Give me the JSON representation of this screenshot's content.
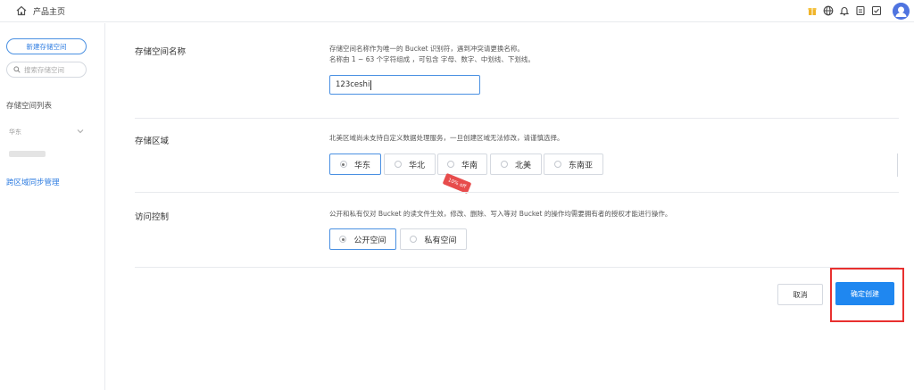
{
  "topbar": {
    "title": "产品主页",
    "icons": [
      "home-icon",
      "gift-icon",
      "globe-icon",
      "bell-icon",
      "document-icon",
      "checkbox-icon",
      "user-avatar-icon"
    ]
  },
  "sidebar": {
    "new_bucket": "新建存储空间",
    "search_placeholder": "搜索存储空间",
    "list_label": "存储空间列表",
    "region": "华东",
    "sync": "跨区域同步管理"
  },
  "form": {
    "name": {
      "label": "存储空间名称",
      "desc1": "存储空间名称作为唯一的 Bucket 识别符，遇到冲突请更换名称。",
      "desc2": "名称由 1 ~ 63 个字符组成 ，可包含 字母、数字、中划线、下划线。",
      "value": "123ceshi"
    },
    "region": {
      "label": "存储区域",
      "desc": "北美区域尚未支持自定义数据处理服务，一旦创建区域无法修改，请谨慎选择。",
      "options": [
        "华东",
        "华北",
        "华南",
        "北美",
        "东南亚"
      ],
      "selected": "华东",
      "tag": "10% off"
    },
    "access": {
      "label": "访问控制",
      "desc": "公开和私有仅对 Bucket 的读文件生效，修改、删除、写入等对 Bucket 的操作均需要拥有者的授权才能进行操作。",
      "options": [
        "公开空间",
        "私有空间"
      ],
      "selected": "公开空间"
    }
  },
  "actions": {
    "cancel": "取消",
    "confirm": "确定创建"
  },
  "colors": {
    "accent": "#1f87f0",
    "highlight": "#e8302f",
    "tag": "#e74c4c"
  }
}
